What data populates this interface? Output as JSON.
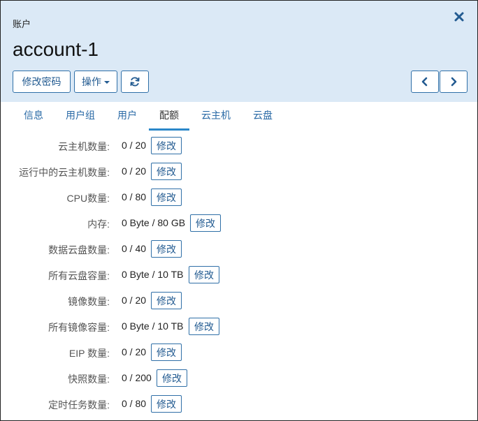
{
  "header": {
    "kicker": "账户",
    "title": "account-1"
  },
  "toolbar": {
    "change_password_label": "修改密码",
    "actions_label": "操作"
  },
  "tabs": [
    {
      "label": "信息"
    },
    {
      "label": "用户组"
    },
    {
      "label": "用户"
    },
    {
      "label": "配额"
    },
    {
      "label": "云主机"
    },
    {
      "label": "云盘"
    }
  ],
  "active_tab": "配额",
  "quotas": [
    {
      "label": "云主机数量:",
      "value": "0 / 20",
      "edit": "修改"
    },
    {
      "label": "运行中的云主机数量:",
      "value": "0 / 20",
      "edit": "修改"
    },
    {
      "label": "CPU数量:",
      "value": "0 / 80",
      "edit": "修改"
    },
    {
      "label": "内存:",
      "value": "0 Byte / 80 GB",
      "edit": "修改"
    },
    {
      "label": "数据云盘数量:",
      "value": "0 / 40",
      "edit": "修改"
    },
    {
      "label": "所有云盘容量:",
      "value": "0 Byte / 10 TB",
      "edit": "修改"
    },
    {
      "label": "镜像数量:",
      "value": "0 / 20",
      "edit": "修改"
    },
    {
      "label": "所有镜像容量:",
      "value": "0 Byte / 10 TB",
      "edit": "修改"
    },
    {
      "label": "EIP 数量:",
      "value": "0 / 20",
      "edit": "修改"
    },
    {
      "label": "快照数量:",
      "value": "0 / 200",
      "edit": "修改"
    },
    {
      "label": "定时任务数量:",
      "value": "0 / 80",
      "edit": "修改"
    }
  ],
  "colors": {
    "header_bg": "#dbe9f6",
    "accent": "#2a87c9",
    "link": "#2a6aa6",
    "button_border": "#2f6fa7"
  },
  "icons": {
    "close": "close-icon",
    "refresh": "refresh-icon",
    "prev": "chevron-left-icon",
    "next": "chevron-right-icon"
  }
}
